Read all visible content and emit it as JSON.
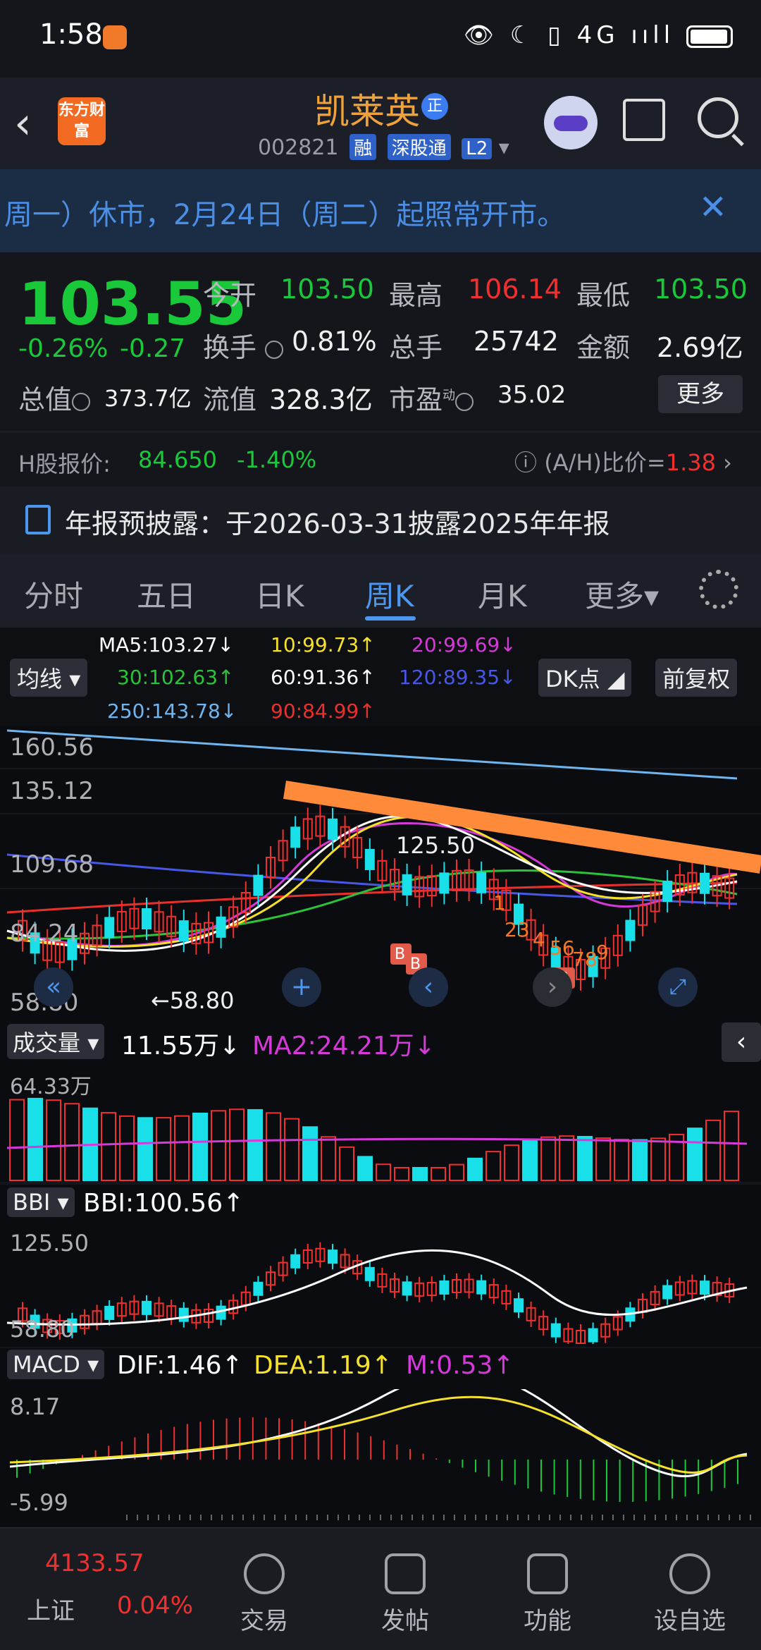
{
  "status": {
    "time": "1:58",
    "right_icons": "👁 ☾ ▯ 4G ııll"
  },
  "header": {
    "name": "凯莱英",
    "zheng_badge": "正",
    "code": "002821",
    "tags": [
      "融",
      "深股通",
      "L2"
    ],
    "logo_text": "东方财富"
  },
  "notice": {
    "text": "周一）休市，2月24日（周二）起照常开市。",
    "close": "✕"
  },
  "quote": {
    "price": "103.55",
    "change_pct": "-0.26%",
    "change": "-0.27",
    "items": [
      {
        "label": "今开",
        "value": "103.50",
        "color": "green"
      },
      {
        "label": "最高",
        "value": "106.14",
        "color": "red"
      },
      {
        "label": "最低",
        "value": "103.50",
        "color": "green"
      },
      {
        "label": "换手",
        "value": "0.81%",
        "color": "white"
      },
      {
        "label": "总手",
        "value": "25742",
        "color": "white"
      },
      {
        "label": "金额",
        "value": "2.69亿",
        "color": "white"
      },
      {
        "label": "总值",
        "value": "373.7亿",
        "color": "white"
      },
      {
        "label": "流值",
        "value": "328.3亿",
        "color": "white"
      },
      {
        "label": "市盈",
        "value": "35.02",
        "color": "white",
        "sup": "动"
      }
    ],
    "more": "更多"
  },
  "hshare": {
    "label": "H股报价:",
    "price": "84.650",
    "pct": "-1.40%",
    "ratio_label": "(A/H)比价=",
    "ratio": "1.38"
  },
  "annual": {
    "text": "年报预披露：于2026-03-31披露2025年年报"
  },
  "tabs": [
    "分时",
    "五日",
    "日K",
    "周K",
    "月K",
    "更多▾"
  ],
  "ma_legend": {
    "ma_button": "均线",
    "dk_button": "DK点",
    "adjust_button": "前复权",
    "row1": [
      {
        "text": "MA5:103.27↓",
        "color": "#ffffff"
      },
      {
        "text": "10:99.73↑",
        "color": "#f5e12b"
      },
      {
        "text": "20:99.69↓",
        "color": "#d53ad9"
      }
    ],
    "row2": [
      {
        "text": "30:102.63↑",
        "color": "#2cc23a"
      },
      {
        "text": "60:91.36↑",
        "color": "#ffffff"
      },
      {
        "text": "120:89.35↓",
        "color": "#4858e6"
      }
    ],
    "row3": [
      {
        "text": "250:143.78↓",
        "color": "#6fb6f0"
      },
      {
        "text": "90:84.99↑",
        "color": "#e8302c"
      }
    ]
  },
  "price_chart": {
    "y_labels": [
      "160.56",
      "135.12",
      "109.68",
      "84.24",
      "58.80"
    ],
    "high_label": "125.50",
    "low_label": "←58.80",
    "markers": [
      "1",
      "23",
      "4",
      "56",
      "78",
      "9"
    ]
  },
  "volume": {
    "indicator": "成交量",
    "value": "11.55万↓",
    "ma2": "MA2:24.21万↓",
    "y_label": "64.33万"
  },
  "bbi": {
    "indicator": "BBI",
    "value": "BBI:100.56↑",
    "y_top": "125.50",
    "y_bottom": "58.80"
  },
  "macd": {
    "indicator": "MACD",
    "dif": "DIF:1.46↑",
    "dea": "DEA:1.19↑",
    "m": "M:0.53↑",
    "y_top": "8.17",
    "y_bottom": "-5.99"
  },
  "bottom": {
    "index_value": "4133.57",
    "index_name": "上证",
    "index_pct": "0.04%",
    "nav": [
      "交易",
      "发帖",
      "功能",
      "设自选"
    ]
  },
  "colors": {
    "up": "#f0302f",
    "down": "#19c93a",
    "accent": "#4e97f0",
    "trend": "#ff8a3a"
  }
}
